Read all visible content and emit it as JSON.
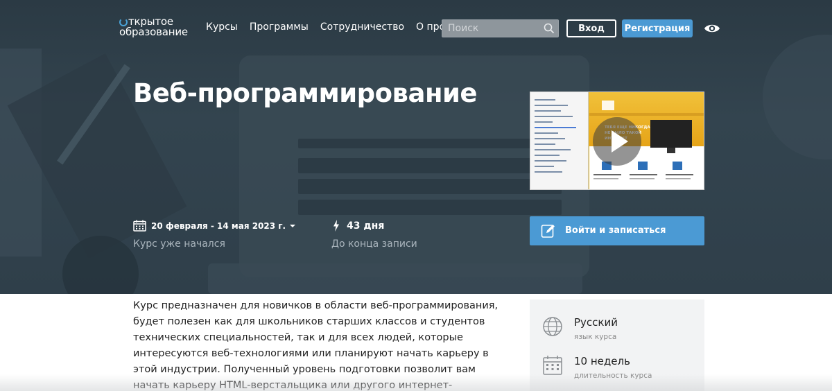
{
  "brand": {
    "line1": "ткрытое",
    "line2": "образование",
    "accent": "#4aa3d8"
  },
  "nav": {
    "links": [
      "Курсы",
      "Программы",
      "Сотрудничество",
      "О проекте"
    ],
    "search_placeholder": "Поиск",
    "login_label": "Вход",
    "register_label": "Регистрация"
  },
  "course": {
    "title": "Веб-программирование",
    "dates": "20 февраля - 14 мая 2023 г.",
    "status": "Курс уже начался",
    "days_left": "43 дня",
    "days_caption": "До конца записи",
    "enroll_label": "Войти и записаться",
    "description": "Курс предназначен для новичков в области веб-программирования, будет полезен как для школьников старших классов и студентов технических специальностей, так и для всех людей, которые интересуются веб-технологиями или планируют начать карьеру в этой индустрии. Полученный уровень подготовки позволит вам начать карьеру HTML-верстальщика или другого интернет-специалиста."
  },
  "video": {
    "overlay_text": "ТЕБЯ ЕЩЕ НИКОГДА НЕ БЫЛО ТАКОЙ ИНТЕРНЕТ"
  },
  "sidebar": {
    "items": [
      {
        "value": "Русский",
        "caption": "язык курса",
        "icon": "globe-icon"
      },
      {
        "value": "10 недель",
        "caption": "длительность курса",
        "icon": "calendar-icon"
      }
    ]
  },
  "colors": {
    "hero_bg": "#2f3f4a",
    "primary": "#4b9ad4",
    "muted_text": "#aab5bd"
  }
}
